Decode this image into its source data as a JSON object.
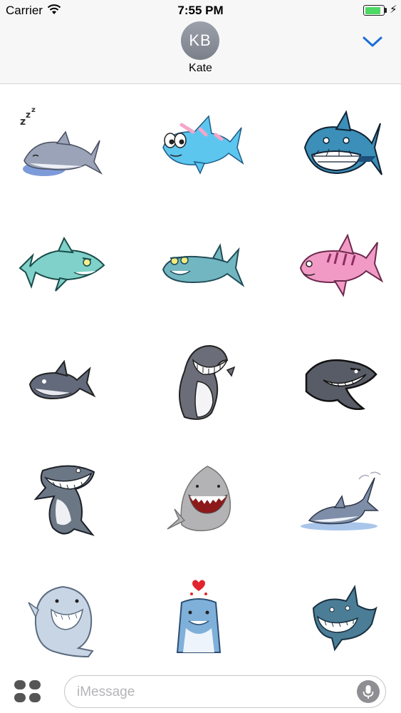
{
  "status_bar": {
    "carrier": "Carrier",
    "time": "7:55 PM",
    "battery_level": 0.85,
    "icons": [
      "wifi-icon",
      "battery-icon",
      "charging-bolt-icon"
    ]
  },
  "header": {
    "avatar_initials": "KB",
    "contact_name": "Kate",
    "collapse_icon": "chevron-down-icon"
  },
  "sticker_pack": {
    "stickers": [
      "sleeping-shark",
      "cute-blue-shark",
      "great-white-grin-shark",
      "angry-teal-shark",
      "sly-shark",
      "pink-striped-shark",
      "small-grey-shark",
      "standing-grin-shark",
      "dark-grey-shark",
      "flexing-shark",
      "open-mouth-shark",
      "beached-shark",
      "chubby-white-shark",
      "love-shark",
      "blue-grin-shark"
    ]
  },
  "input_bar": {
    "apps_icon": "app-drawer-icon",
    "placeholder": "iMessage",
    "mic_icon": "microphone-icon"
  },
  "colors": {
    "accent": "#1a6fd6",
    "battery_green": "#4cd964",
    "bar_background": "#f7f7f7"
  }
}
